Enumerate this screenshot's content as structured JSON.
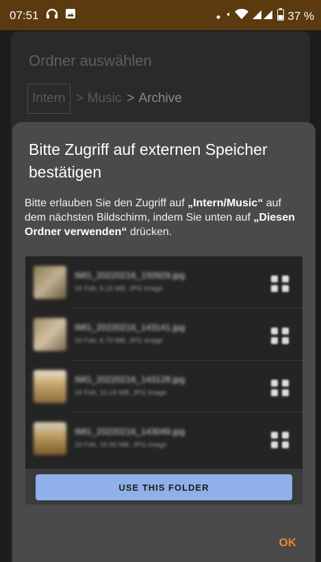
{
  "status_bar": {
    "time": "07:51",
    "battery_pct": "37 %",
    "icons": [
      "headphones-icon",
      "image-icon",
      "dot-icon",
      "signal-icon",
      "wifi-icon",
      "cell-icon",
      "battery-icon"
    ]
  },
  "background": {
    "title": "Ordner auswählen",
    "breadcrumb": [
      "Intern",
      "Music",
      "Archive"
    ]
  },
  "dialog": {
    "title": "Bitte Zugriff auf externen Speicher bestätigen",
    "body_1": "Bitte erlauben Sie den Zugriff auf ",
    "body_bold_1": "„Intern/Music“",
    "body_2": " auf dem nächsten Bildschirm, indem Sie unten auf ",
    "body_bold_2": "„Diesen Ordner verwenden“",
    "body_3": " drücken.",
    "ok_label": "OK"
  },
  "preview": {
    "files": [
      {
        "name": "IMG_20220216_150929.jpg",
        "meta": "16 Feb, 6.16 MB, JPG image"
      },
      {
        "name": "IMG_20220216_143141.jpg",
        "meta": "16 Feb, 6.70 MB, JPG image"
      },
      {
        "name": "IMG_20220216_143128.jpg",
        "meta": "16 Feb, 10.16 MB, JPG image"
      },
      {
        "name": "IMG_20220216_143049.jpg",
        "meta": "16 Feb, 10.60 MB, JPG image"
      }
    ],
    "use_folder_label": "USE THIS FOLDER"
  },
  "colors": {
    "accent": "#e8862c",
    "status_bar": "#5b3a10",
    "button": "#8fb0e8"
  }
}
